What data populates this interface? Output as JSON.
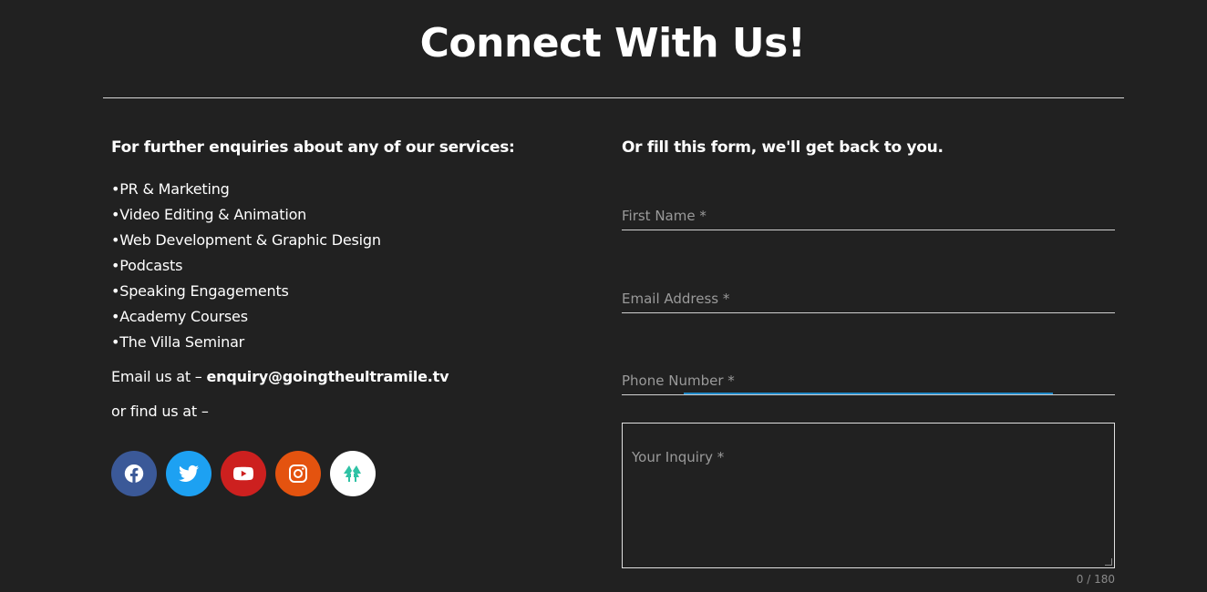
{
  "header": {
    "title": "Connect With Us!"
  },
  "contact": {
    "heading": "For further enquiries about any of our services:",
    "services": [
      "•PR & Marketing",
      "•Video Editing & Animation",
      "•Web Development & Graphic Design",
      "•Podcasts",
      "•Speaking Engagements",
      "•Academy Courses",
      "•The Villa Seminar"
    ],
    "email_prefix": "Email us at – ",
    "email": "enquiry@goingtheultramile.tv",
    "find_text": "or find us at –",
    "socials": [
      {
        "name": "facebook",
        "icon": "facebook-icon",
        "color": "#3b5998"
      },
      {
        "name": "twitter",
        "icon": "twitter-icon",
        "color": "#1da1f2"
      },
      {
        "name": "youtube",
        "icon": "youtube-icon",
        "color": "#cd201f"
      },
      {
        "name": "instagram",
        "icon": "instagram-icon",
        "color": "#e4530f"
      },
      {
        "name": "linktree",
        "icon": "linktree-icon",
        "color": "#ffffff"
      }
    ]
  },
  "form": {
    "heading": "Or fill this form, we'll get back to you.",
    "first_name_placeholder": "First Name *",
    "email_placeholder": "Email Address *",
    "phone_placeholder": "Phone Number *",
    "inquiry_placeholder": "Your Inquiry *",
    "counter": "0 / 180",
    "focus_color": "#1e88c7"
  }
}
